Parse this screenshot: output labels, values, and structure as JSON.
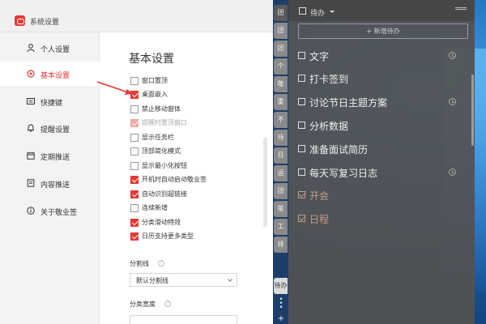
{
  "window": {
    "title": "系统设置"
  },
  "sidebar": {
    "items": [
      {
        "label": "个人设置",
        "icon": "user-icon"
      },
      {
        "label": "基本设置",
        "icon": "target-icon",
        "active": true
      },
      {
        "label": "快捷键",
        "icon": "keyboard-icon"
      },
      {
        "label": "提醒设置",
        "icon": "bell-icon"
      },
      {
        "label": "定期推送",
        "icon": "calendar-icon"
      },
      {
        "label": "内容推送",
        "icon": "document-icon"
      },
      {
        "label": "关于敬业签",
        "icon": "info-icon"
      }
    ]
  },
  "main": {
    "section_title": "基本设置",
    "options": [
      {
        "label": "窗口置顶",
        "checked": false
      },
      {
        "label": "桌面嵌入",
        "checked": true
      },
      {
        "label": "禁止移动窗体",
        "checked": false
      },
      {
        "label": "提醒时置顶窗口",
        "checked": true,
        "disabled": true
      },
      {
        "label": "显示任务栏",
        "checked": false
      },
      {
        "label": "顶部简化模式",
        "checked": false
      },
      {
        "label": "显示最小化按钮",
        "checked": false
      },
      {
        "label": "开机时自动启动敬业签",
        "checked": true
      },
      {
        "label": "自动识别超链接",
        "checked": true
      },
      {
        "label": "连续新增",
        "checked": false
      },
      {
        "label": "分类滑动特效",
        "checked": true
      },
      {
        "label": "日历支持更多类型",
        "checked": true
      }
    ],
    "divider_label": "分割线",
    "divider_value": "默认分割线",
    "width_label": "分类宽度"
  },
  "tabs": [
    "团",
    "团",
    "团",
    "个",
    "敬",
    "重",
    "不",
    "待",
    "日",
    "运",
    "团",
    "笔",
    "工",
    "排",
    "待办"
  ],
  "panel": {
    "title": "待办",
    "new_button": "+ 新增待办",
    "tasks": [
      {
        "text": "文字",
        "done": false,
        "clock": true
      },
      {
        "text": "打卡签到",
        "done": false,
        "clock": false
      },
      {
        "text": "讨论节日主题方案",
        "done": false,
        "clock": true
      },
      {
        "text": "分析数据",
        "done": false,
        "clock": false
      },
      {
        "text": "准备面试简历",
        "done": false,
        "clock": false
      },
      {
        "text": "每天写复习日志",
        "done": false,
        "clock": true
      },
      {
        "text": "开会",
        "done": true,
        "clock": false
      },
      {
        "text": "日程",
        "done": true,
        "clock": false
      }
    ]
  },
  "colors": {
    "accent": "#e53935",
    "panel_bg": "#525252",
    "done_text": "#c89c84"
  }
}
